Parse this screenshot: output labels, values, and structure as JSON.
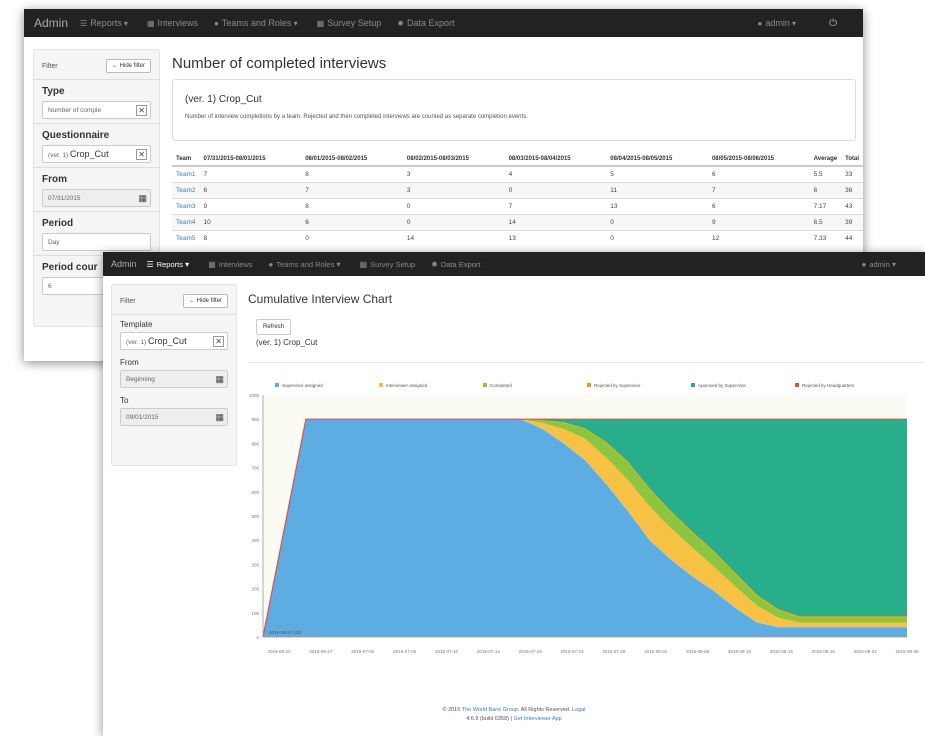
{
  "back_window": {
    "navbar": {
      "brand": "Admin",
      "items": [
        "Reports",
        "Interviews",
        "Teams and Roles",
        "Survey Setup",
        "Data Export"
      ],
      "user": "admin"
    },
    "sidebar": {
      "filter_label": "Filter",
      "hide_filter_label": "Hide filter",
      "type_label": "Type",
      "type_value": "Number of comple",
      "questionnaire_label": "Questionnaire",
      "questionnaire_prefix": "(ver. 1)",
      "questionnaire_value": "Crop_Cut",
      "from_label": "From",
      "from_value": "07/31/2015",
      "period_label": "Period",
      "period_value": "Day",
      "period_count_label": "Period cour",
      "period_count_value": "6"
    },
    "main": {
      "title": "Number of completed interviews",
      "questionnaire_title": "(ver. 1) Crop_Cut",
      "description": "Number of interview completions by a team. Rejected and then completed interviews are counted as separate completion events.",
      "table": {
        "headers": [
          "Team",
          "07/31/2015-08/01/2015",
          "08/01/2015-08/02/2015",
          "08/02/2015-08/03/2015",
          "08/03/2015-08/04/2015",
          "08/04/2015-08/05/2015",
          "08/05/2015-08/06/2015",
          "Average",
          "Total"
        ],
        "rows": [
          [
            "Team1",
            "7",
            "8",
            "3",
            "4",
            "5",
            "6",
            "5.5",
            "33"
          ],
          [
            "Team2",
            "6",
            "7",
            "3",
            "0",
            "11",
            "7",
            "6",
            "36"
          ],
          [
            "Team3",
            "9",
            "8",
            "0",
            "7",
            "13",
            "6",
            "7.17",
            "43"
          ],
          [
            "Team4",
            "10",
            "6",
            "0",
            "14",
            "0",
            "9",
            "6.5",
            "39"
          ],
          [
            "Team5",
            "8",
            "0",
            "14",
            "13",
            "0",
            "12",
            "7.33",
            "44"
          ]
        ]
      }
    }
  },
  "front_window": {
    "navbar": {
      "brand": "Admin",
      "items": [
        "Reports",
        "Interviews",
        "Teams and Roles",
        "Survey Setup",
        "Data Export"
      ],
      "user": "admin"
    },
    "sidebar": {
      "filter_label": "Filter",
      "hide_filter_label": "Hide filter",
      "template_label": "Template",
      "template_prefix": "(ver. 1)",
      "template_value": "Crop_Cut",
      "from_label": "From",
      "from_value": "Beginning",
      "to_label": "To",
      "to_value": "09/01/2015"
    },
    "main": {
      "title": "Cumulative Interview Chart",
      "refresh_label": "Refresh",
      "subtitle": "(ver. 1) Crop_Cut"
    },
    "footer": {
      "copyright": "© 2015",
      "org": "The World Bank Group.",
      "rights": "All Rights Reserved.",
      "legal": "Legal",
      "version": "4.6.9 (build 6358) |",
      "app": "Get Interviewer App"
    }
  },
  "chart_data": {
    "type": "area",
    "stacked": true,
    "title": "",
    "legend_position": "top",
    "ylim": [
      0,
      1000
    ],
    "yticks": [
      0,
      100,
      200,
      300,
      400,
      500,
      600,
      700,
      800,
      900,
      1000
    ],
    "xticks": [
      "2015-06-22",
      "2015-06-27",
      "2015-07-02",
      "2015-07-06",
      "2015-07-10",
      "2015-07-14",
      "2015-07-19",
      "2015-07-24",
      "2015-07-28",
      "2015-08-01",
      "2015-08-06",
      "2015-08-10",
      "2015-08-15",
      "2015-08-19",
      "2015-08-24",
      "2015-08-30"
    ],
    "annotation": "2015-06-22 (42)",
    "x": [
      0,
      1,
      2,
      3,
      4,
      5,
      6,
      6.5,
      7,
      7.5,
      8,
      8.5,
      9,
      9.5,
      10,
      10.5,
      11,
      11.5,
      12,
      12.5,
      13,
      14,
      15
    ],
    "series": [
      {
        "name": "Supervisor assigned",
        "color": "#5dade2",
        "values": [
          0,
          900,
          900,
          900,
          900,
          900,
          900,
          860,
          800,
          730,
          630,
          520,
          400,
          320,
          250,
          190,
          120,
          60,
          40,
          40,
          40,
          40,
          40
        ]
      },
      {
        "name": "Interviewer assigned",
        "color": "#f7c244",
        "values": [
          0,
          0,
          0,
          0,
          0,
          0,
          0,
          25,
          60,
          90,
          110,
          130,
          140,
          130,
          120,
          100,
          90,
          70,
          40,
          20,
          20,
          20,
          20
        ]
      },
      {
        "name": "Completed",
        "color": "#8cc63f",
        "values": [
          0,
          0,
          0,
          0,
          0,
          0,
          0,
          10,
          25,
          40,
          60,
          70,
          70,
          65,
          60,
          60,
          50,
          40,
          30,
          20,
          20,
          20,
          20
        ]
      },
      {
        "name": "Rejected by Supervisor",
        "color": "#f39c12",
        "values": [
          0,
          0,
          0,
          0,
          0,
          0,
          0,
          1,
          2,
          3,
          5,
          5,
          5,
          5,
          5,
          5,
          5,
          5,
          5,
          5,
          5,
          5,
          5
        ]
      },
      {
        "name": "Approved by Supervisor",
        "color": "#27ae8a",
        "values": [
          0,
          0,
          0,
          0,
          0,
          0,
          0,
          4,
          13,
          37,
          95,
          175,
          285,
          380,
          465,
          545,
          635,
          725,
          785,
          815,
          815,
          815,
          815
        ]
      },
      {
        "name": "Rejected by Headquarters",
        "color": "#e74c3c",
        "values": [
          0,
          0,
          0,
          0,
          0,
          0,
          0,
          0,
          0,
          0,
          0,
          0,
          0,
          0,
          0,
          0,
          0,
          0,
          0,
          0,
          0,
          0,
          0
        ]
      }
    ]
  }
}
